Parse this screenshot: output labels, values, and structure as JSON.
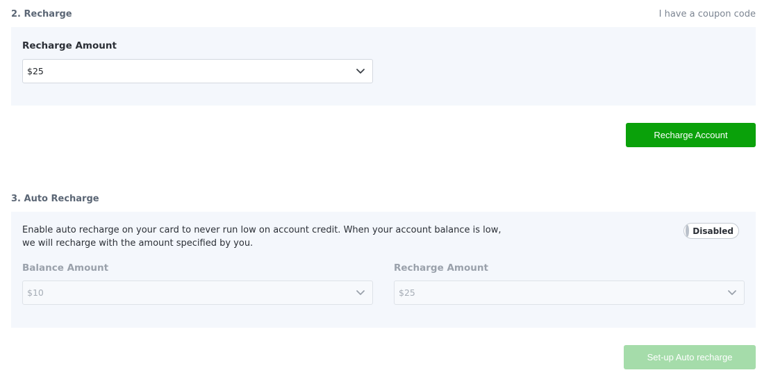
{
  "recharge": {
    "title": "2. Recharge",
    "coupon_link": "I have a coupon code",
    "amount_label": "Recharge Amount",
    "amount_value": "$25",
    "button_label": "Recharge Account"
  },
  "auto_recharge": {
    "title": "3. Auto Recharge",
    "description_line1": "Enable auto recharge on your card to never run low on account credit. When your account balance is low,",
    "description_line2": "we will recharge with the amount specified by you.",
    "toggle_label": "Disabled",
    "balance_label": "Balance Amount",
    "balance_value": "$10",
    "recharge_label": "Recharge Amount",
    "recharge_value": "$25",
    "button_label": "Set-up Auto recharge"
  },
  "icons": {
    "dropdown": "chevron-down-icon"
  },
  "colors": {
    "primary_button": "#0aa10a",
    "disabled_button": "#a5dcaa",
    "panel_background": "#f4f7fc"
  }
}
